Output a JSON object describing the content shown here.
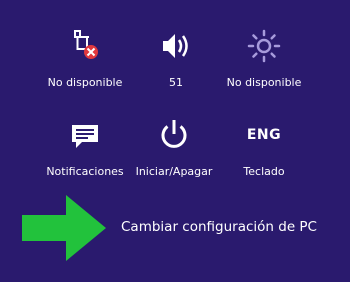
{
  "quick_settings": {
    "network": {
      "icon": "network-unavailable-icon",
      "label": "No disponible"
    },
    "volume": {
      "icon": "speaker-icon",
      "label": "51"
    },
    "brightness": {
      "icon": "brightness-icon",
      "label": "No disponible"
    },
    "notifications": {
      "icon": "notifications-icon",
      "label": "Notificaciones"
    },
    "power": {
      "icon": "power-icon",
      "label": "Iniciar/Apagar"
    },
    "keyboard": {
      "icon_text": "ENG",
      "label": "Teclado"
    }
  },
  "change_pc_settings": {
    "label": "Cambiar configuración de PC"
  },
  "colors": {
    "background": "#2a1a6e",
    "text": "#ffffff",
    "arrow": "#22c23c",
    "error_badge": "#e0383e",
    "brightness": "#a79bdc"
  }
}
